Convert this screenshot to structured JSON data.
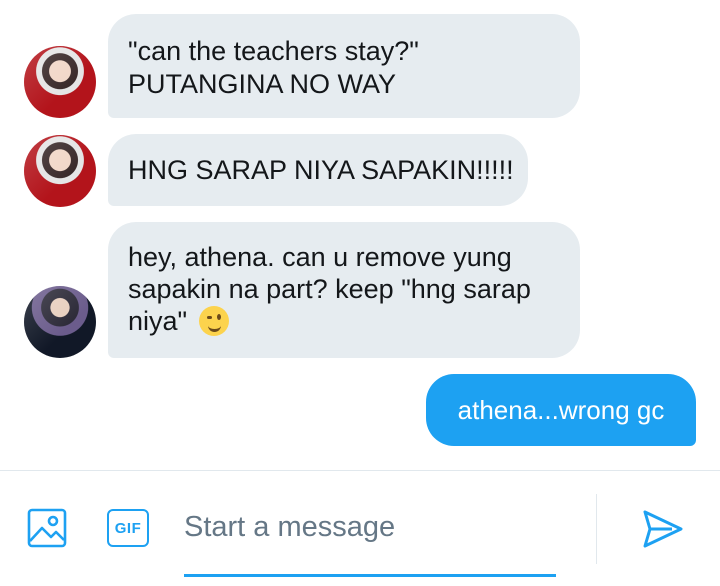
{
  "messages": [
    {
      "sender": "other",
      "avatar": "avatar-red-jacket",
      "lines": [
        "\"can the teachers stay?\"",
        "PUTANGINA NO WAY"
      ]
    },
    {
      "sender": "other",
      "avatar": "avatar-red-jacket",
      "lines": [
        "HNG SARAP NIYA SAPAKIN!!!!!"
      ]
    },
    {
      "sender": "other",
      "avatar": "avatar-dark-suit",
      "lines": [
        "hey, athena. can u remove yung",
        "sapakin na part? keep \"hng sarap",
        "niya\""
      ],
      "emoji": "winking-face-emoji"
    },
    {
      "sender": "me",
      "text": "athena...wrong gc"
    }
  ],
  "composer": {
    "placeholder": "Start a message",
    "value": "",
    "gif_label": "GIF",
    "icons": [
      "image-icon",
      "gif-icon",
      "send-icon"
    ]
  },
  "colors": {
    "accent": "#1da1f2",
    "incoming_bubble": "#e6ecf0",
    "text": "#14171a",
    "placeholder": "#657786"
  }
}
